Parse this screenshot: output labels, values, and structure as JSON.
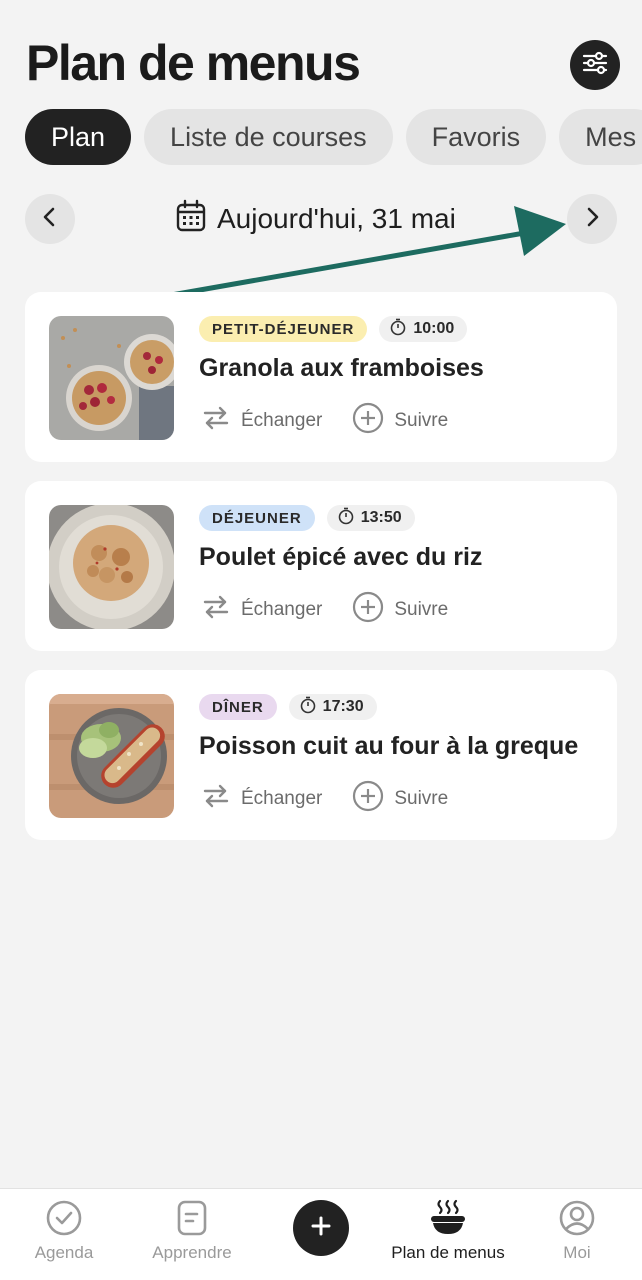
{
  "header": {
    "title": "Plan de menus"
  },
  "tabs": [
    {
      "label": "Plan"
    },
    {
      "label": "Liste de courses"
    },
    {
      "label": "Favoris"
    },
    {
      "label": "Mes"
    }
  ],
  "date_nav": {
    "label": "Aujourd'hui, 31 mai"
  },
  "meals": [
    {
      "category": "PETIT-DÉJEUNER",
      "time": "10:00",
      "name": "Granola aux framboises",
      "swap_label": "Échanger",
      "track_label": "Suivre"
    },
    {
      "category": "DÉJEUNER",
      "time": "13:50",
      "name": "Poulet épicé avec du riz",
      "swap_label": "Échanger",
      "track_label": "Suivre"
    },
    {
      "category": "DÎNER",
      "time": "17:30",
      "name": "Poisson cuit au four à la greque",
      "swap_label": "Échanger",
      "track_label": "Suivre"
    }
  ],
  "bottom_nav": {
    "items": [
      {
        "label": "Agenda"
      },
      {
        "label": "Apprendre"
      },
      {
        "label": "Plan de menus"
      },
      {
        "label": "Moi"
      }
    ]
  },
  "colors": {
    "background": "#f3f3f3",
    "dark": "#222222",
    "annotation_arrow": "#1d6b60",
    "badge_breakfast": "#fbeeb0",
    "badge_lunch": "#cfe2f8",
    "badge_dinner": "#e9d9ef"
  }
}
